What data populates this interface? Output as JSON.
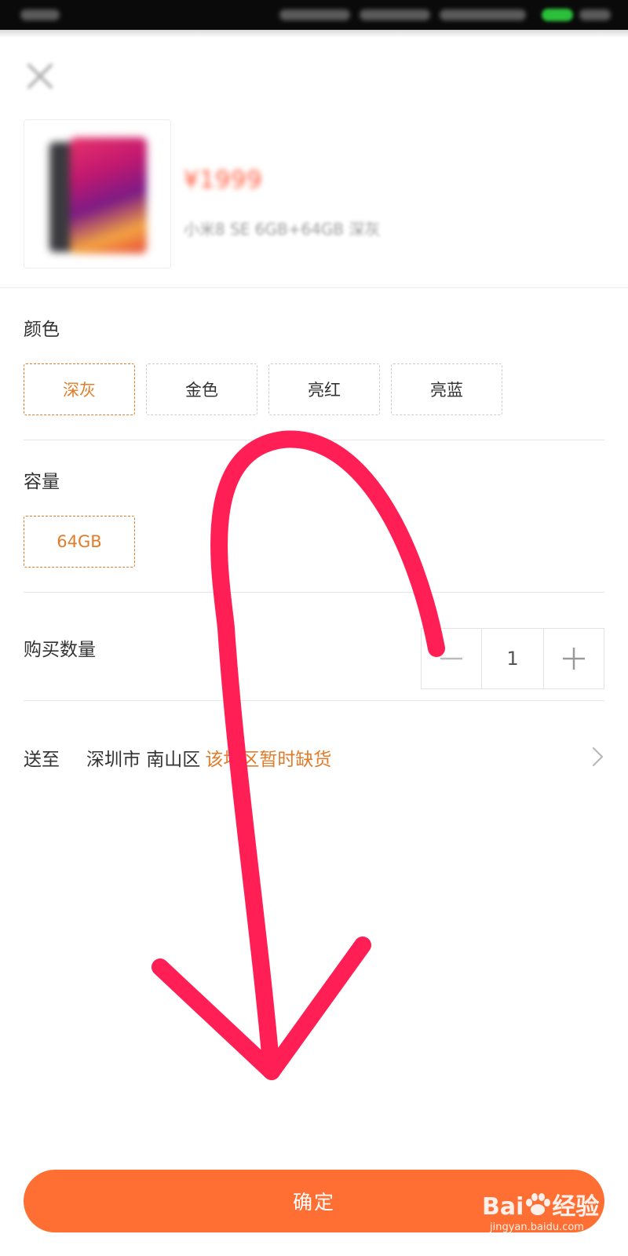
{
  "product": {
    "price": "¥1999",
    "name": "小米8 SE 6GB+64GB 深灰"
  },
  "color_section": {
    "label": "颜色",
    "options": [
      "深灰",
      "金色",
      "亮红",
      "亮蓝"
    ],
    "selected_index": 0
  },
  "capacity_section": {
    "label": "容量",
    "options": [
      "64GB"
    ],
    "selected_index": 0
  },
  "quantity_section": {
    "label": "购买数量",
    "value": "1"
  },
  "shipping": {
    "label": "送至",
    "address": "深圳市 南山区",
    "status": "该地区暂时缺货"
  },
  "confirm_button": {
    "label": "确定"
  },
  "watermark": {
    "brand": "Bai",
    "brand_tail": "经验",
    "url": "jingyan.baidu.com"
  },
  "colors": {
    "accent": "#ff6f33",
    "selected_border": "#e07c2a",
    "price": "#ff5a3c",
    "annotation_arrow": "#ff1f55"
  }
}
